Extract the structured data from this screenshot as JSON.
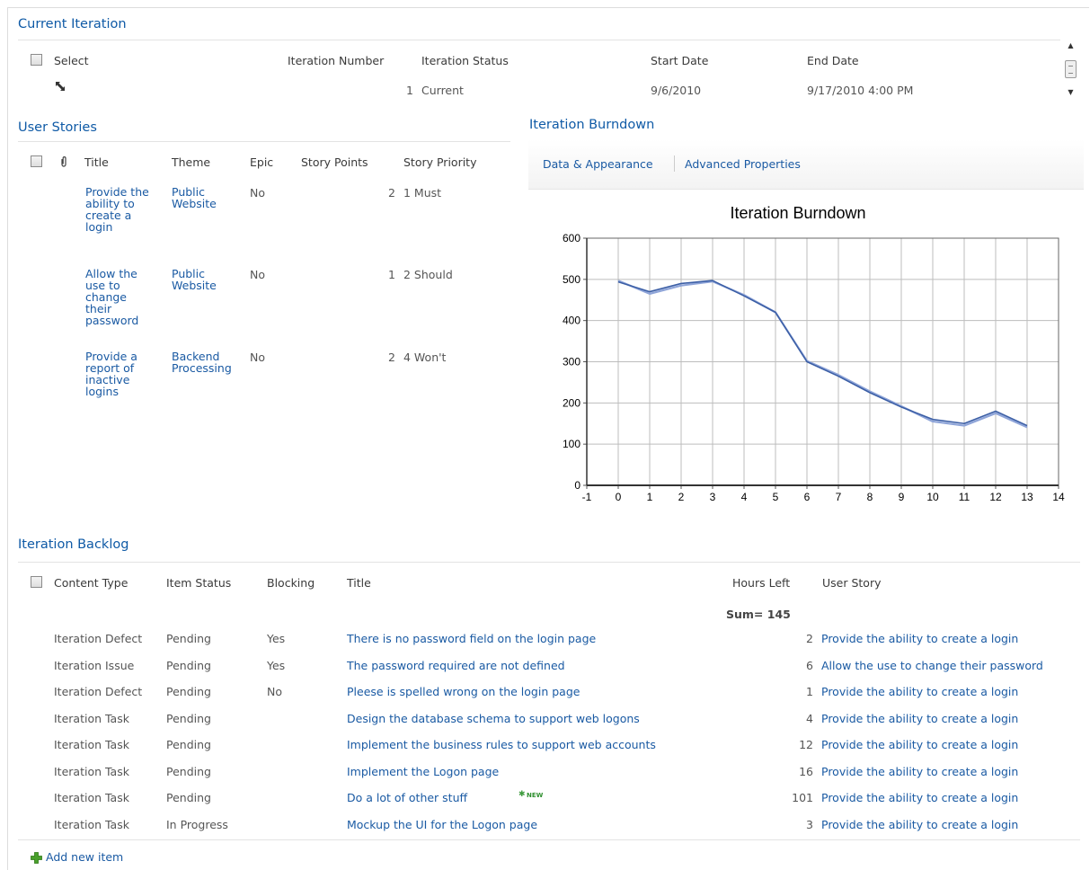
{
  "current_iteration": {
    "title": "Current Iteration",
    "headers": {
      "select": "Select",
      "iteration_number": "Iteration Number",
      "iteration_status": "Iteration Status",
      "start_date": "Start Date",
      "end_date": "End Date"
    },
    "row": {
      "iteration_number": "1",
      "iteration_status": "Current",
      "start_date": "9/6/2010",
      "end_date": "9/17/2010 4:00 PM"
    }
  },
  "user_stories": {
    "title": "User Stories",
    "headers": {
      "title": "Title",
      "theme": "Theme",
      "epic": "Epic",
      "story_points": "Story Points",
      "story_priority": "Story Priority"
    },
    "rows": [
      {
        "title": "Provide the ability to create a login",
        "theme": "Public Website",
        "epic": "No",
        "story_points": "2",
        "story_priority": "1 Must"
      },
      {
        "title": "Allow the use to change their password",
        "theme": "Public Website",
        "epic": "No",
        "story_points": "1",
        "story_priority": "2 Should"
      },
      {
        "title": "Provide a report of inactive logins",
        "theme": "Backend Processing",
        "epic": "No",
        "story_points": "2",
        "story_priority": "4 Won't"
      }
    ]
  },
  "burndown": {
    "title": "Iteration Burndown",
    "toolbar": {
      "data_appearance": "Data & Appearance",
      "advanced_properties": "Advanced Properties"
    }
  },
  "chart_data": {
    "type": "line",
    "title": "Iteration Burndown",
    "xlabel": "",
    "ylabel": "",
    "xlim": [
      -1,
      14
    ],
    "ylim": [
      0,
      600
    ],
    "x_ticks": [
      "-1",
      "0",
      "1",
      "2",
      "3",
      "4",
      "5",
      "6",
      "7",
      "8",
      "9",
      "10",
      "11",
      "12",
      "13",
      "14"
    ],
    "y_ticks": [
      "0",
      "100",
      "200",
      "300",
      "400",
      "500",
      "600"
    ],
    "grid": true,
    "legend": "none",
    "series": [
      {
        "x": [
          0,
          1,
          2,
          3,
          4,
          5,
          6,
          7,
          8,
          9,
          10,
          11,
          12,
          13
        ],
        "y": [
          497,
          465,
          485,
          495,
          462,
          420,
          302,
          268,
          228,
          192,
          155,
          145,
          175,
          141
        ],
        "color": "#8ea4d8"
      },
      {
        "x": [
          0,
          1,
          2,
          3,
          4,
          5,
          6,
          7,
          8,
          9,
          10,
          11,
          12,
          13
        ],
        "y": [
          494,
          470,
          490,
          497,
          460,
          420,
          300,
          265,
          225,
          190,
          160,
          150,
          180,
          145
        ],
        "color": "#3c5fa6"
      }
    ]
  },
  "iteration_backlog": {
    "title": "Iteration Backlog",
    "headers": {
      "content_type": "Content Type",
      "item_status": "Item Status",
      "blocking": "Blocking",
      "title": "Title",
      "hours_left": "Hours Left",
      "user_story": "User Story"
    },
    "sum_label": "Sum= 145",
    "rows": [
      {
        "content_type": "Iteration Defect",
        "item_status": "Pending",
        "blocking": "Yes",
        "title": "There is no password field on the login page",
        "hours_left": "2",
        "user_story": "Provide the ability to create a login"
      },
      {
        "content_type": "Iteration Issue",
        "item_status": "Pending",
        "blocking": "Yes",
        "title": "The password required are not defined",
        "hours_left": "6",
        "user_story": "Allow the use to change their password"
      },
      {
        "content_type": "Iteration Defect",
        "item_status": "Pending",
        "blocking": "No",
        "title": "Pleese is spelled wrong on the login page",
        "hours_left": "1",
        "user_story": "Provide the ability to create a login"
      },
      {
        "content_type": "Iteration Task",
        "item_status": "Pending",
        "blocking": "",
        "title": "Design the database schema to support web logons",
        "hours_left": "4",
        "user_story": "Provide the ability to create a login"
      },
      {
        "content_type": "Iteration Task",
        "item_status": "Pending",
        "blocking": "",
        "title": "Implement the business rules to support web accounts",
        "hours_left": "12",
        "user_story": "Provide the ability to create a login"
      },
      {
        "content_type": "Iteration Task",
        "item_status": "Pending",
        "blocking": "",
        "title": "Implement the Logon page",
        "hours_left": "16",
        "user_story": "Provide the ability to create a login"
      },
      {
        "content_type": "Iteration Task",
        "item_status": "Pending",
        "blocking": "",
        "title": "Do a lot of other stuff",
        "hours_left": "101",
        "user_story": "Provide the ability to create a login",
        "badge": "NEW"
      },
      {
        "content_type": "Iteration Task",
        "item_status": "In Progress",
        "blocking": "",
        "title": "Mockup the UI for the Logon page",
        "hours_left": "3",
        "user_story": "Provide the ability to create a login"
      }
    ],
    "add_new_item": "Add new item"
  }
}
